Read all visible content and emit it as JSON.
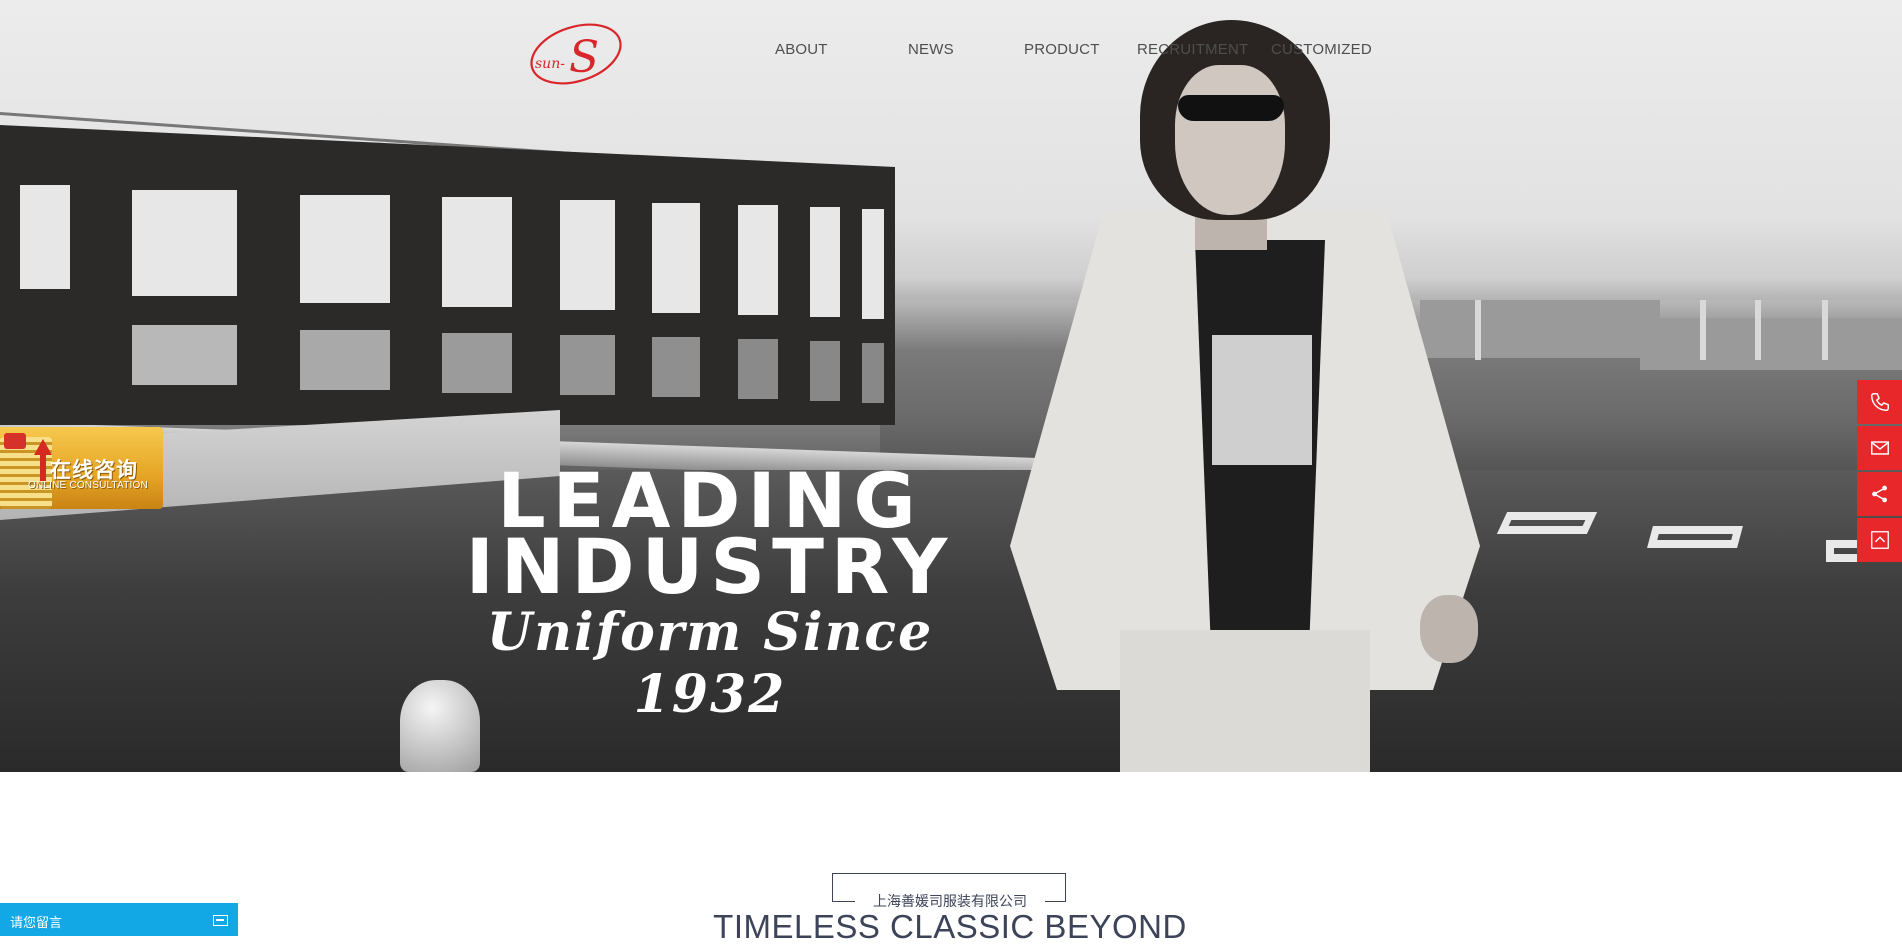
{
  "header": {
    "logo_text": "sun-S",
    "nav": [
      {
        "label": "ABOUT"
      },
      {
        "label": "NEWS"
      },
      {
        "label": "PRODUCT"
      },
      {
        "label": "RECRUITMENT"
      },
      {
        "label": "CUSTOMIZED"
      }
    ]
  },
  "hero": {
    "line1": "LEADING",
    "line2": "INDUSTRY",
    "line3": "Uniform Since 1932"
  },
  "consult_widget": {
    "title": "在线咨询",
    "subtitle": "ONLINE CONSULTATION"
  },
  "side_tools": [
    {
      "icon": "phone-icon"
    },
    {
      "icon": "mail-icon"
    },
    {
      "icon": "share-icon"
    },
    {
      "icon": "back-to-top-icon"
    }
  ],
  "intro": {
    "company": "上海善媛司服装有限公司",
    "tagline": "TIMELESS CLASSIC BEYOND"
  },
  "message_bar": {
    "label": "请您留言"
  },
  "colors": {
    "accent_red": "#e8272b",
    "message_blue": "#12a8e6",
    "text_navy": "#3d4459"
  }
}
